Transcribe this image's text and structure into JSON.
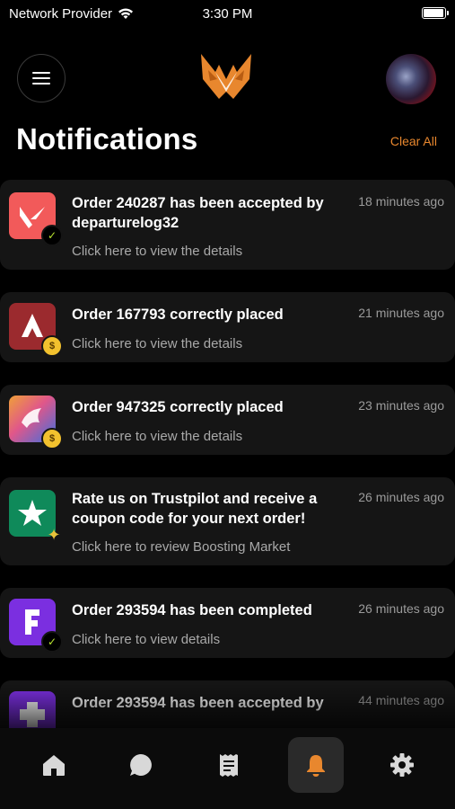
{
  "status_bar": {
    "carrier": "Network Provider",
    "time": "3:30 PM",
    "battery_level": 0.95
  },
  "header": {
    "title": "Notifications",
    "clear_all_label": "Clear All"
  },
  "colors": {
    "accent": "#e8872e",
    "card_bg": "#151515",
    "background": "#000000"
  },
  "notifications": [
    {
      "title": "Order 240287 has been accepted by departurelog32",
      "subtitle": "Click here to view the details",
      "time": "18 minutes ago",
      "icon": "valorant-icon",
      "badge": "check-badge"
    },
    {
      "title": "Order 167793 correctly placed",
      "subtitle": "Click here to view the details",
      "time": "21 minutes ago",
      "icon": "apex-icon",
      "badge": "coin-badge"
    },
    {
      "title": "Order 947325 correctly placed",
      "subtitle": "Click here to view the details",
      "time": "23 minutes ago",
      "icon": "rocket-league-icon",
      "badge": "coin-badge"
    },
    {
      "title": "Rate us on Trustpilot and receive a coupon code for your next order!",
      "subtitle": "Click here to review Boosting Market",
      "time": "26 minutes ago",
      "icon": "trustpilot-icon",
      "badge": "key-badge"
    },
    {
      "title": "Order 293594 has been completed",
      "subtitle": "Click here to view details",
      "time": "26 minutes ago",
      "icon": "fortnite-icon",
      "badge": "check-badge"
    },
    {
      "title": "Order 293594 has been accepted by",
      "subtitle": "",
      "time": "44 minutes ago",
      "icon": "game-icon",
      "badge": ""
    }
  ],
  "tabs": [
    {
      "name": "home-icon",
      "active": false
    },
    {
      "name": "chat-icon",
      "active": false
    },
    {
      "name": "orders-icon",
      "active": false
    },
    {
      "name": "bell-icon",
      "active": true
    },
    {
      "name": "settings-icon",
      "active": false
    }
  ]
}
